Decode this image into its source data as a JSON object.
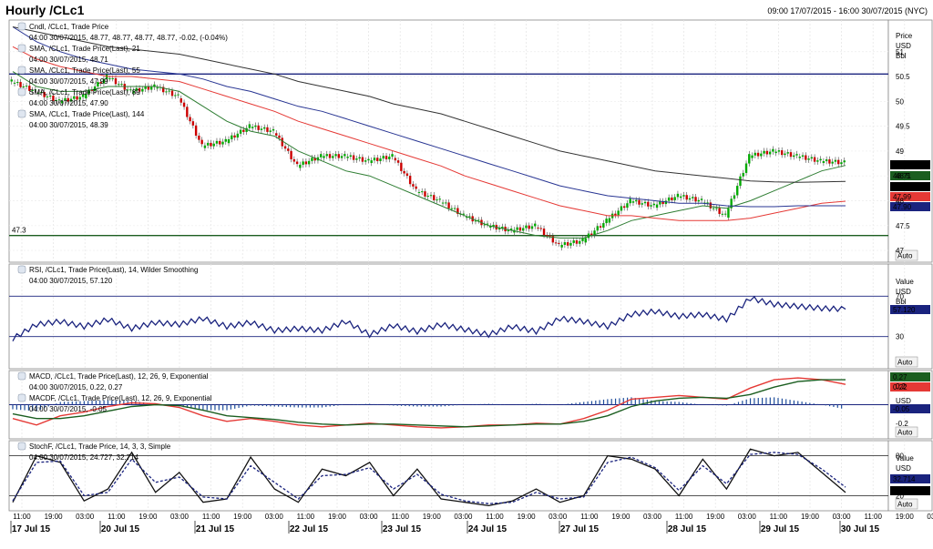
{
  "header": {
    "title": "Hourly /CLc1",
    "date_range": "09:00 17/07/2015 - 16:00 30/07/2015 (NYC)"
  },
  "colors": {
    "candle_up": "#00aa00",
    "candle_down": "#cc0000",
    "sma21": "#2e7d32",
    "sma55": "#e53935",
    "sma89": "#283593",
    "sma144": "#333333",
    "rsi": "#1a237e",
    "macd": "#e53935",
    "macd_signal": "#1b5e20",
    "macd_hist": "#1f4e9c",
    "stoch_k": "#111111",
    "stoch_d": "#1a237e",
    "hline": "#1a237e"
  },
  "legend": {
    "candle": {
      "name": "Cndl, /CLc1, Trade Price",
      "values": "04:00 30/07/2015, 48.77, 48.77, 48.77, 48.77, -0.02, (-0.04%)"
    },
    "sma21": {
      "name": "SMA, /CLc1, Trade Price(Last), 21",
      "values": "04:00 30/07/2015, 48.71"
    },
    "sma55": {
      "name": "SMA, /CLc1, Trade Price(Last), 55",
      "values": "04:00 30/07/2015, 47.99"
    },
    "sma89": {
      "name": "SMA, /CLc1, Trade Price(Last), 89",
      "values": "04:00 30/07/2015, 47.90"
    },
    "sma144": {
      "name": "SMA, /CLc1, Trade Price(Last), 144",
      "values": "04:00 30/07/2015, 48.39"
    },
    "rsi": {
      "name": "RSI, /CLc1, Trade Price(Last), 14, Wilder Smoothing",
      "values": "04:00 30/07/2015, 57.120"
    },
    "macd": {
      "name": "MACD, /CLc1, Trade Price(Last), 12, 26, 9, Exponential",
      "values": "04:00 30/07/2015, 0.22, 0.27"
    },
    "macdf": {
      "name": "MACDF, /CLc1, Trade Price(Last), 12, 26, 9, Exponential",
      "values": "04:00 30/07/2015, -0.05"
    },
    "stoch": {
      "name": "StochF, /CLc1, Trade Price, 14, 3, 3, Simple",
      "values": "04:00 30/07/2015, 24.727, 32.714"
    }
  },
  "axis_headers": {
    "price": [
      "Price",
      "USD",
      "Bbl"
    ],
    "rsi": [
      "Value",
      "USD",
      "Bbl"
    ],
    "macd": [
      "USD"
    ],
    "stoch": [
      "Value",
      "USD"
    ],
    "auto": "Auto"
  },
  "axis_ticks": {
    "price": [
      "51",
      "50.5",
      "50",
      "49.5",
      "49",
      "48.5",
      "48",
      "47.5",
      "47"
    ],
    "rsi": [
      "70",
      "30"
    ],
    "macd": [
      "0.2",
      "-0.2"
    ],
    "stoch": [
      "80",
      "20"
    ]
  },
  "hline_labels": {
    "support": "47.3"
  },
  "last_value_tags": {
    "price": [
      {
        "text": "48.77",
        "bg": "#000000",
        "fg": "#ffffff"
      },
      {
        "text": "48.71",
        "bg": "#1b5e20",
        "fg": "#ffffff"
      },
      {
        "text": "48.39",
        "bg": "#000000",
        "fg": "#ffffff"
      },
      {
        "text": "47.99",
        "bg": "#e53935",
        "fg": "#ffffff"
      },
      {
        "text": "47.90",
        "bg": "#1a237e",
        "fg": "#ffffff"
      }
    ],
    "rsi": [
      {
        "text": "57.120",
        "bg": "#1a237e",
        "fg": "#ffffff"
      }
    ],
    "macd": [
      {
        "text": "0.27",
        "bg": "#1b5e20",
        "fg": "#ffffff"
      },
      {
        "text": "0.22",
        "bg": "#e53935",
        "fg": "#ffffff"
      },
      {
        "text": "-0.05",
        "bg": "#1a237e",
        "fg": "#ffffff"
      }
    ],
    "stoch": [
      {
        "text": "32.714",
        "bg": "#1a237e",
        "fg": "#ffffff"
      },
      {
        "text": "24.727",
        "bg": "#000000",
        "fg": "#ffffff"
      }
    ]
  },
  "time_axis": {
    "hour_labels": [
      "11:00",
      "19:00",
      "03:00",
      "11:00",
      "19:00",
      "03:00",
      "11:00",
      "19:00",
      "03:00",
      "11:00",
      "19:00",
      "03:00",
      "11:00",
      "19:00",
      "03:00",
      "11:00",
      "19:00",
      "03:00",
      "11:00",
      "19:00",
      "03:00",
      "11:00",
      "19:00",
      "03:00",
      "11:00",
      "19:00",
      "03:00",
      "11:00",
      "19:00",
      "03:00"
    ],
    "date_labels": [
      "17 Jul 15",
      "20 Jul 15",
      "21 Jul 15",
      "22 Jul 15",
      "23 Jul 15",
      "24 Jul 15",
      "27 Jul 15",
      "28 Jul 15",
      "29 Jul 15",
      "30 Jul 15"
    ]
  },
  "chart_data": [
    {
      "type": "candlestick",
      "title": "Hourly /CLc1",
      "ylabel": "Price USD Bbl",
      "ylim": [
        46.8,
        51.6
      ],
      "x": [
        "17 Jul 15",
        "20 Jul 15",
        "21 Jul 15",
        "22 Jul 15",
        "23 Jul 15",
        "24 Jul 15",
        "27 Jul 15",
        "28 Jul 15",
        "29 Jul 15",
        "30 Jul 15"
      ],
      "horizontal_lines": [
        50.55,
        47.3
      ],
      "series": [
        {
          "name": "Trade Price",
          "values": [
            50.4,
            50.2,
            50.0,
            50.1,
            50.5,
            50.2,
            50.3,
            50.1,
            49.1,
            49.2,
            49.5,
            49.4,
            48.7,
            48.9,
            48.9,
            48.8,
            48.9,
            48.2,
            48.0,
            47.7,
            47.5,
            47.4,
            47.5,
            47.1,
            47.2,
            47.6,
            48.0,
            47.9,
            48.1,
            48.0,
            47.7,
            48.9,
            49.0,
            48.9,
            48.8,
            48.77
          ]
        },
        {
          "name": "SMA 21",
          "values": [
            50.6,
            50.3,
            50.2,
            50.2,
            50.3,
            50.3,
            50.3,
            50.2,
            49.9,
            49.6,
            49.4,
            49.3,
            49.0,
            48.8,
            48.6,
            48.5,
            48.3,
            48.1,
            47.9,
            47.7,
            47.5,
            47.4,
            47.3,
            47.25,
            47.25,
            47.4,
            47.6,
            47.7,
            47.8,
            47.9,
            47.85,
            48.0,
            48.2,
            48.4,
            48.6,
            48.71
          ]
        },
        {
          "name": "SMA 55",
          "values": [
            51.1,
            50.85,
            50.7,
            50.6,
            50.5,
            50.5,
            50.45,
            50.4,
            50.25,
            50.1,
            49.95,
            49.8,
            49.6,
            49.45,
            49.3,
            49.15,
            49.0,
            48.85,
            48.7,
            48.5,
            48.35,
            48.2,
            48.05,
            47.9,
            47.8,
            47.7,
            47.7,
            47.65,
            47.6,
            47.6,
            47.6,
            47.65,
            47.75,
            47.85,
            47.95,
            47.99
          ]
        },
        {
          "name": "SMA 89",
          "values": [
            51.5,
            51.2,
            51.0,
            50.85,
            50.75,
            50.65,
            50.6,
            50.55,
            50.45,
            50.3,
            50.2,
            50.05,
            49.9,
            49.8,
            49.65,
            49.5,
            49.35,
            49.2,
            49.05,
            48.9,
            48.75,
            48.6,
            48.45,
            48.3,
            48.2,
            48.1,
            48.05,
            48.0,
            47.95,
            47.95,
            47.9,
            47.88,
            47.88,
            47.9,
            47.9,
            47.9
          ]
        },
        {
          "name": "SMA 144",
          "values": [
            51.5,
            51.4,
            51.3,
            51.2,
            51.1,
            51.05,
            51.0,
            50.95,
            50.85,
            50.75,
            50.65,
            50.55,
            50.4,
            50.3,
            50.2,
            50.1,
            49.95,
            49.85,
            49.75,
            49.6,
            49.45,
            49.3,
            49.15,
            49.0,
            48.9,
            48.8,
            48.7,
            48.6,
            48.55,
            48.5,
            48.45,
            48.4,
            48.38,
            48.37,
            48.38,
            48.39
          ]
        }
      ]
    },
    {
      "type": "line",
      "title": "RSI",
      "ylim": [
        0,
        100
      ],
      "horizontal_lines": [
        70,
        30
      ],
      "series": [
        {
          "name": "RSI",
          "values": [
            28,
            42,
            45,
            40,
            47,
            38,
            44,
            42,
            48,
            40,
            44,
            36,
            38,
            36,
            45,
            32,
            41,
            35,
            42,
            37,
            32,
            40,
            35,
            48,
            45,
            40,
            52,
            55,
            50,
            52,
            47,
            68,
            62,
            60,
            58,
            57.12
          ]
        }
      ]
    },
    {
      "type": "line",
      "title": "MACD",
      "ylim": [
        -0.35,
        0.35
      ],
      "horizontal_lines": [
        0
      ],
      "series": [
        {
          "name": "MACD",
          "values": [
            -0.15,
            -0.22,
            -0.12,
            -0.08,
            -0.02,
            0.02,
            0.01,
            -0.03,
            -0.12,
            -0.18,
            -0.15,
            -0.18,
            -0.22,
            -0.24,
            -0.22,
            -0.2,
            -0.22,
            -0.24,
            -0.25,
            -0.24,
            -0.22,
            -0.22,
            -0.2,
            -0.21,
            -0.15,
            -0.06,
            0.06,
            0.08,
            0.1,
            0.08,
            0.06,
            0.18,
            0.27,
            0.29,
            0.27,
            0.22
          ]
        },
        {
          "name": "Signal",
          "values": [
            -0.1,
            -0.15,
            -0.15,
            -0.12,
            -0.07,
            -0.02,
            0.0,
            -0.01,
            -0.06,
            -0.12,
            -0.14,
            -0.16,
            -0.19,
            -0.21,
            -0.22,
            -0.21,
            -0.21,
            -0.22,
            -0.23,
            -0.24,
            -0.23,
            -0.22,
            -0.21,
            -0.21,
            -0.18,
            -0.12,
            -0.02,
            0.04,
            0.07,
            0.08,
            0.07,
            0.11,
            0.19,
            0.25,
            0.27,
            0.27
          ]
        },
        {
          "name": "MACDF",
          "values": [
            -0.05,
            -0.07,
            0.03,
            0.04,
            0.05,
            0.04,
            0.01,
            -0.02,
            -0.06,
            -0.06,
            -0.01,
            -0.02,
            -0.03,
            -0.03,
            0.0,
            0.01,
            -0.01,
            -0.02,
            -0.02,
            0.0,
            0.01,
            0.0,
            0.01,
            0.0,
            0.03,
            0.06,
            0.08,
            0.04,
            0.03,
            0.0,
            -0.01,
            0.07,
            0.08,
            0.04,
            0.0,
            -0.05
          ]
        }
      ]
    },
    {
      "type": "line",
      "title": "StochF",
      "ylim": [
        0,
        100
      ],
      "horizontal_lines": [
        80,
        20
      ],
      "series": [
        {
          "name": "%K",
          "values": [
            10,
            80,
            70,
            12,
            30,
            85,
            25,
            55,
            10,
            15,
            78,
            30,
            10,
            60,
            50,
            70,
            20,
            60,
            15,
            10,
            5,
            12,
            30,
            10,
            20,
            80,
            75,
            60,
            20,
            75,
            30,
            90,
            80,
            85,
            55,
            24.727
          ]
        },
        {
          "name": "%D",
          "values": [
            12,
            70,
            72,
            20,
            25,
            75,
            40,
            48,
            18,
            15,
            65,
            40,
            15,
            50,
            52,
            62,
            30,
            52,
            22,
            12,
            8,
            10,
            25,
            15,
            18,
            70,
            78,
            62,
            28,
            65,
            38,
            82,
            85,
            82,
            60,
            32.714
          ]
        }
      ]
    }
  ]
}
